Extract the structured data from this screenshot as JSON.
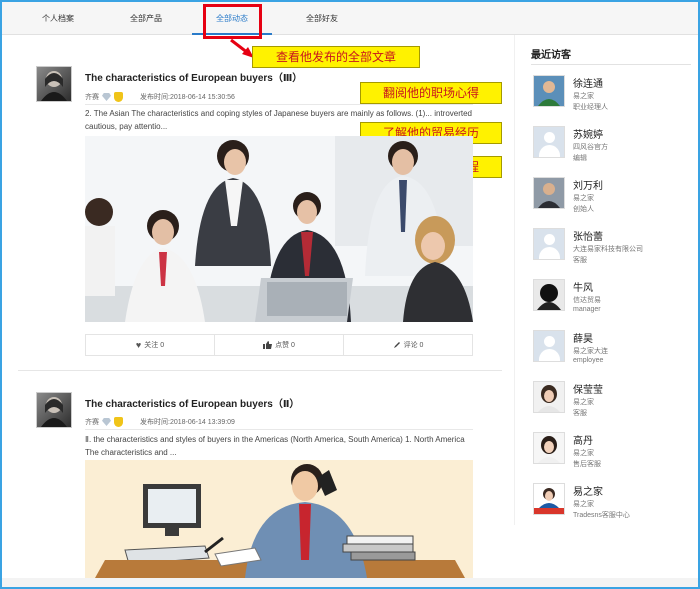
{
  "tabs": [
    {
      "label": "个人档案"
    },
    {
      "label": "全部产品"
    },
    {
      "label": "全部动态"
    },
    {
      "label": "全部好友"
    }
  ],
  "callouts": {
    "articles": "查看他发布的全部文章",
    "experience": "翻阅他的职场心得",
    "trade": "了解他的贸易经历",
    "journey": "共享他的心路历程"
  },
  "posts": [
    {
      "title": "The characteristics of European buyers（Ⅲ）",
      "author": "齐赛",
      "date_label": "发布时间:2018-06-14 15:30:56",
      "excerpt": "2. The Asian The characteristics and coping styles of Japanese buyers are mainly as follows. (1)... introverted cautious, pay attentio...",
      "actions": {
        "follow": "关注 0",
        "like": "点赞 0",
        "comment": "评论 0"
      }
    },
    {
      "title": "The characteristics of European buyers（Ⅱ）",
      "author": "齐赛",
      "date_label": "发布时间:2018-06-14 13:39:09",
      "excerpt": "Ⅱ. the characteristics and styles of buyers in the Americas (North America, South America)  1. North America The characteristics and ..."
    }
  ],
  "sidebar": {
    "title": "最近访客",
    "visitors": [
      {
        "name": "徐连通",
        "line1": "易之家",
        "line2": "职业经理人"
      },
      {
        "name": "苏婉婷",
        "line1": "四风谷官方",
        "line2": "编辑"
      },
      {
        "name": "刘万利",
        "line1": "易之家",
        "line2": "创始人"
      },
      {
        "name": "张怡蕾",
        "line1": "大连易家科技有限公司",
        "line2": "客服"
      },
      {
        "name": "牛风",
        "line1": "信达贸易",
        "line2": "manager"
      },
      {
        "name": "薛昊",
        "line1": "易之家大连",
        "line2": "employee"
      },
      {
        "name": "保莹莹",
        "line1": "易之家",
        "line2": "客服"
      },
      {
        "name": "高丹",
        "line1": "易之家",
        "line2": "售后客服"
      },
      {
        "name": "易之家",
        "line1": "易之家",
        "line2": "Tradesns客服中心"
      }
    ]
  },
  "colors": {
    "accent": "#2a7bc9",
    "highlight": "#e60012",
    "callout_bg": "#fff200"
  }
}
